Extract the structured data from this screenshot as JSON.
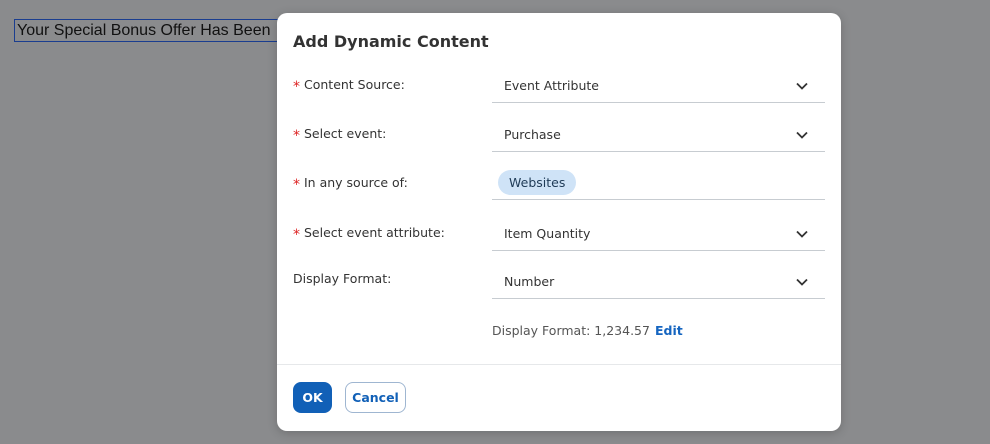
{
  "background": {
    "editor_text": "Your Special Bonus Offer Has Been"
  },
  "dialog": {
    "title": "Add Dynamic Content",
    "fields": [
      {
        "label": "Content Source",
        "required": true,
        "value": "Event Attribute",
        "control": "dropdown"
      },
      {
        "label": "Select event",
        "required": true,
        "value": "Purchase",
        "control": "dropdown"
      },
      {
        "label": "In any source of",
        "required": true,
        "chip": "Websites",
        "control": "chip-input"
      },
      {
        "label": "Select event attribute",
        "required": true,
        "value": "Item Quantity",
        "control": "dropdown"
      },
      {
        "label": "Display Format",
        "required": false,
        "value": "Number",
        "control": "dropdown"
      }
    ],
    "label_suffix": ":",
    "format_preview": "Display Format: 1,234.57",
    "edit_link": "Edit",
    "ok_label": "OK",
    "cancel_label": "Cancel"
  },
  "colors": {
    "overlay": "#8a8b8d",
    "primary": "#1160b7",
    "required": "#dd2222",
    "chip_bg": "#cfe3f7"
  },
  "icons": {
    "dropdown": "chevron-down-icon",
    "required": "asterisk-icon"
  }
}
